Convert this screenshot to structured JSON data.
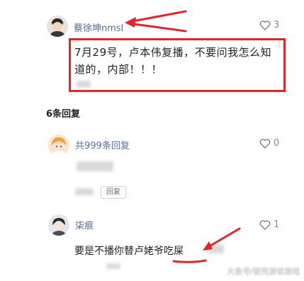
{
  "comment": {
    "username": "蔡徐坤nmsl",
    "likes": "3",
    "text": "7月29号，卢本伟复播，不要问我怎么知道的，内部！！！"
  },
  "replies_header": "6条回复",
  "reply_thread": {
    "reply_count_link": "共999条回复",
    "likes": "0",
    "reply_button": "回复"
  },
  "reply_user2": {
    "username": "柒痕",
    "likes": "1",
    "text": "要是不播你替卢姥爷吃屎"
  },
  "watermark": "大鱼号/替壳游说游戏",
  "colors": {
    "annotation_red": "#e0252c",
    "username_blue": "#4f6c9a"
  }
}
